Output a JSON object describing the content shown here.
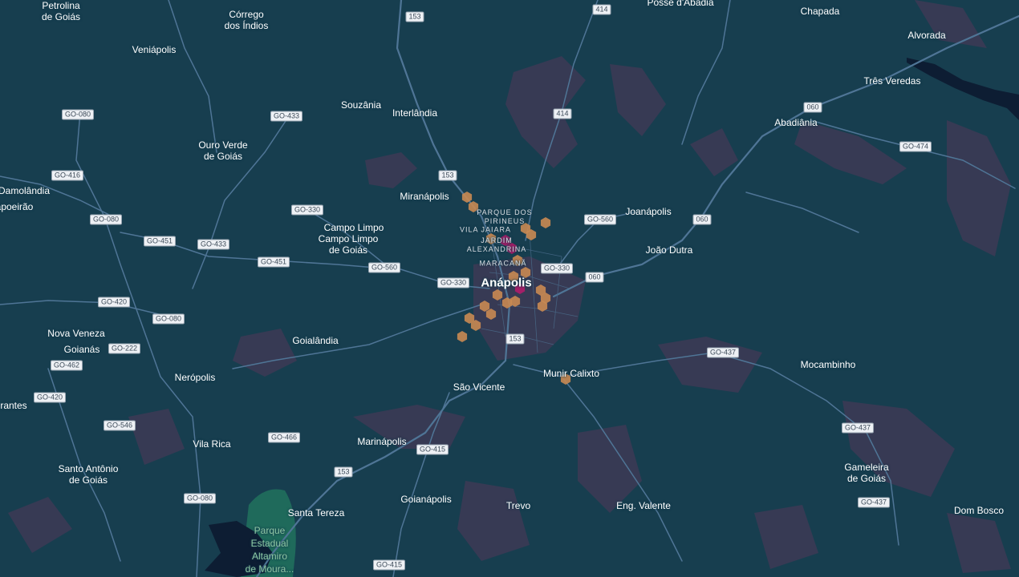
{
  "places": [
    {
      "id": "petrolina",
      "text": "Petrolina\nde Goiás"
    },
    {
      "id": "corrego",
      "text": "Córrego\ndos Índios"
    },
    {
      "id": "posse",
      "text": "Posse d'Abadia"
    },
    {
      "id": "chapada",
      "text": "Chapada"
    },
    {
      "id": "alvorada",
      "text": "Alvorada"
    },
    {
      "id": "veniapolis",
      "text": "Veniápolis"
    },
    {
      "id": "tres-veredas",
      "text": "Três Veredas"
    },
    {
      "id": "souzania",
      "text": "Souzânia"
    },
    {
      "id": "interlandia",
      "text": "Interlândia"
    },
    {
      "id": "abadiania",
      "text": "Abadiânia"
    },
    {
      "id": "ouro-verde",
      "text": "Ouro Verde\nde Goiás"
    },
    {
      "id": "damolandia",
      "text": "Damolândia"
    },
    {
      "id": "pirapoeirao",
      "text": "apoeirão"
    },
    {
      "id": "miranapolis",
      "text": "Miranápolis"
    },
    {
      "id": "joanapolis",
      "text": "Joanápolis"
    },
    {
      "id": "campo-limpo-1",
      "text": "Campo Limpo"
    },
    {
      "id": "campo-limpo-2",
      "text": "Campo Limpo\nde Goiás"
    },
    {
      "id": "joao-dutra",
      "text": "João Dutra"
    },
    {
      "id": "anapolis",
      "text": "Anápolis"
    },
    {
      "id": "nova-veneza",
      "text": "Nova Veneza"
    },
    {
      "id": "goianas",
      "text": "Goianás"
    },
    {
      "id": "goialandia",
      "text": "Goialândia"
    },
    {
      "id": "nerópolis",
      "text": "Nerópolis"
    },
    {
      "id": "munir-calixto",
      "text": "Munir Calixto"
    },
    {
      "id": "mocambinho",
      "text": "Mocambinho"
    },
    {
      "id": "sao-vicente",
      "text": "São Vicente"
    },
    {
      "id": "brantes",
      "text": "rantes"
    },
    {
      "id": "vila-rica",
      "text": "Vila Rica"
    },
    {
      "id": "marinapolis",
      "text": "Marinápolis"
    },
    {
      "id": "santo-antonio",
      "text": "Santo Antônio\nde Goiás"
    },
    {
      "id": "gameleira",
      "text": "Gameleira\nde Goiás"
    },
    {
      "id": "santa-tereza",
      "text": "Santa Tereza"
    },
    {
      "id": "goianapolis",
      "text": "Goianápolis"
    },
    {
      "id": "trevo",
      "text": "Trevo"
    },
    {
      "id": "eng-valente",
      "text": "Eng. Valente"
    },
    {
      "id": "dom-bosco",
      "text": "Dom Bosco"
    }
  ],
  "neighborhoods": [
    {
      "id": "parque-pirineus",
      "text": "PARQUE DOS\nPIRINEUS"
    },
    {
      "id": "vila-jaiara",
      "text": "VILA JAIARA"
    },
    {
      "id": "jardim-alexandrina",
      "text": "JARDIM\nALEXANDRINA"
    },
    {
      "id": "maracana",
      "text": "MARACANÃ"
    }
  ],
  "park": {
    "text": "Parque\nEstadual\nAltamiro\nde Moura..."
  },
  "shields": [
    "153",
    "414",
    "GO-080",
    "GO-433",
    "414",
    "060",
    "GO-474",
    "GO-416",
    "153",
    "GO-330",
    "GO-080",
    "GO-560",
    "060",
    "GO-451",
    "GO-433",
    "GO-451",
    "GO-330",
    "GO-560",
    "GO-330",
    "060",
    "GO-420",
    "GO-080",
    "GO-222",
    "153",
    "GO-437",
    "GO-462",
    "GO-420",
    "GO-546",
    "GO-466",
    "GO-415",
    "153",
    "GO-437",
    "GO-080",
    "GO-437",
    "GO-415"
  ],
  "colors": {
    "background": "#173e4f",
    "road": "#4f7596",
    "heat_low": "#3d3a55",
    "hex_orange": "#c98a52",
    "hex_magenta": "#b01d6a",
    "park_fill": "#1f6a5b",
    "water": "#0d1d33"
  }
}
